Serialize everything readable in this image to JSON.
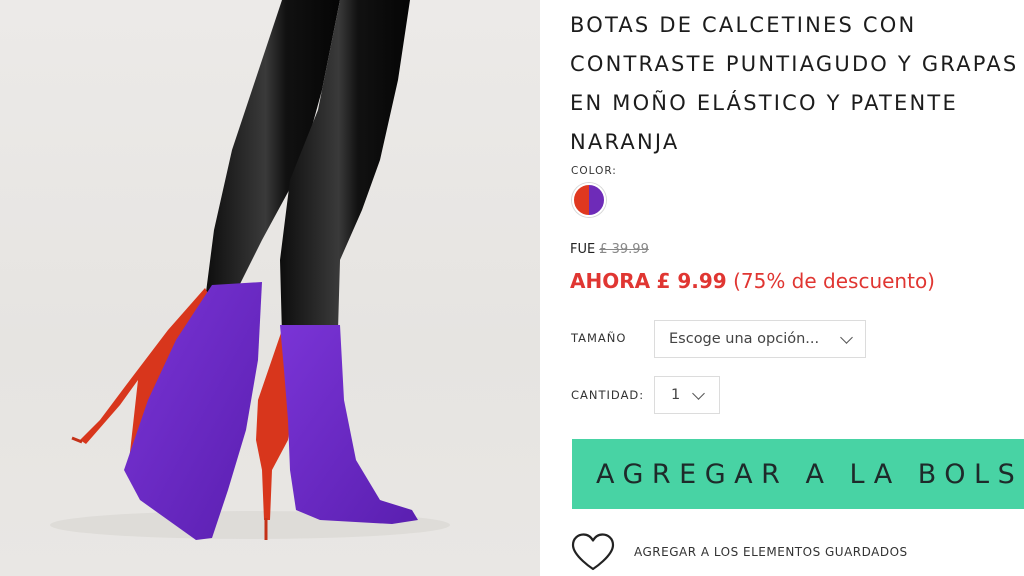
{
  "product": {
    "title_lines": [
      "BOTAS DE CALCETINES CON",
      "CONTRASTE PUNTIAGUDO Y GRAPAS",
      "EN MOÑO ELÁSTICO Y PATENTE",
      "NARANJA"
    ],
    "image_alt_icon": "product-photo-boots"
  },
  "color": {
    "label": "COLOR:",
    "swatch_colors": [
      "#e0381f",
      "#6e2bb8"
    ]
  },
  "price": {
    "was_label": "FUE",
    "was_price": "£ 39.99",
    "now_label": "AHORA",
    "now_price": "£ 9.99",
    "discount": "(75% de descuento)",
    "sale_color": "#e03632"
  },
  "size": {
    "label": "TAMAÑO",
    "selected": "Escoge una opción..."
  },
  "quantity": {
    "label": "CANTIDAD:",
    "selected": "1"
  },
  "actions": {
    "add_to_bag": "AGREGAR A LA BOLSA",
    "add_button_color": "#48d3a4",
    "save_label": "AGREGAR A LOS ELEMENTOS GUARDADOS",
    "save_icon": "heart-outline-icon"
  }
}
